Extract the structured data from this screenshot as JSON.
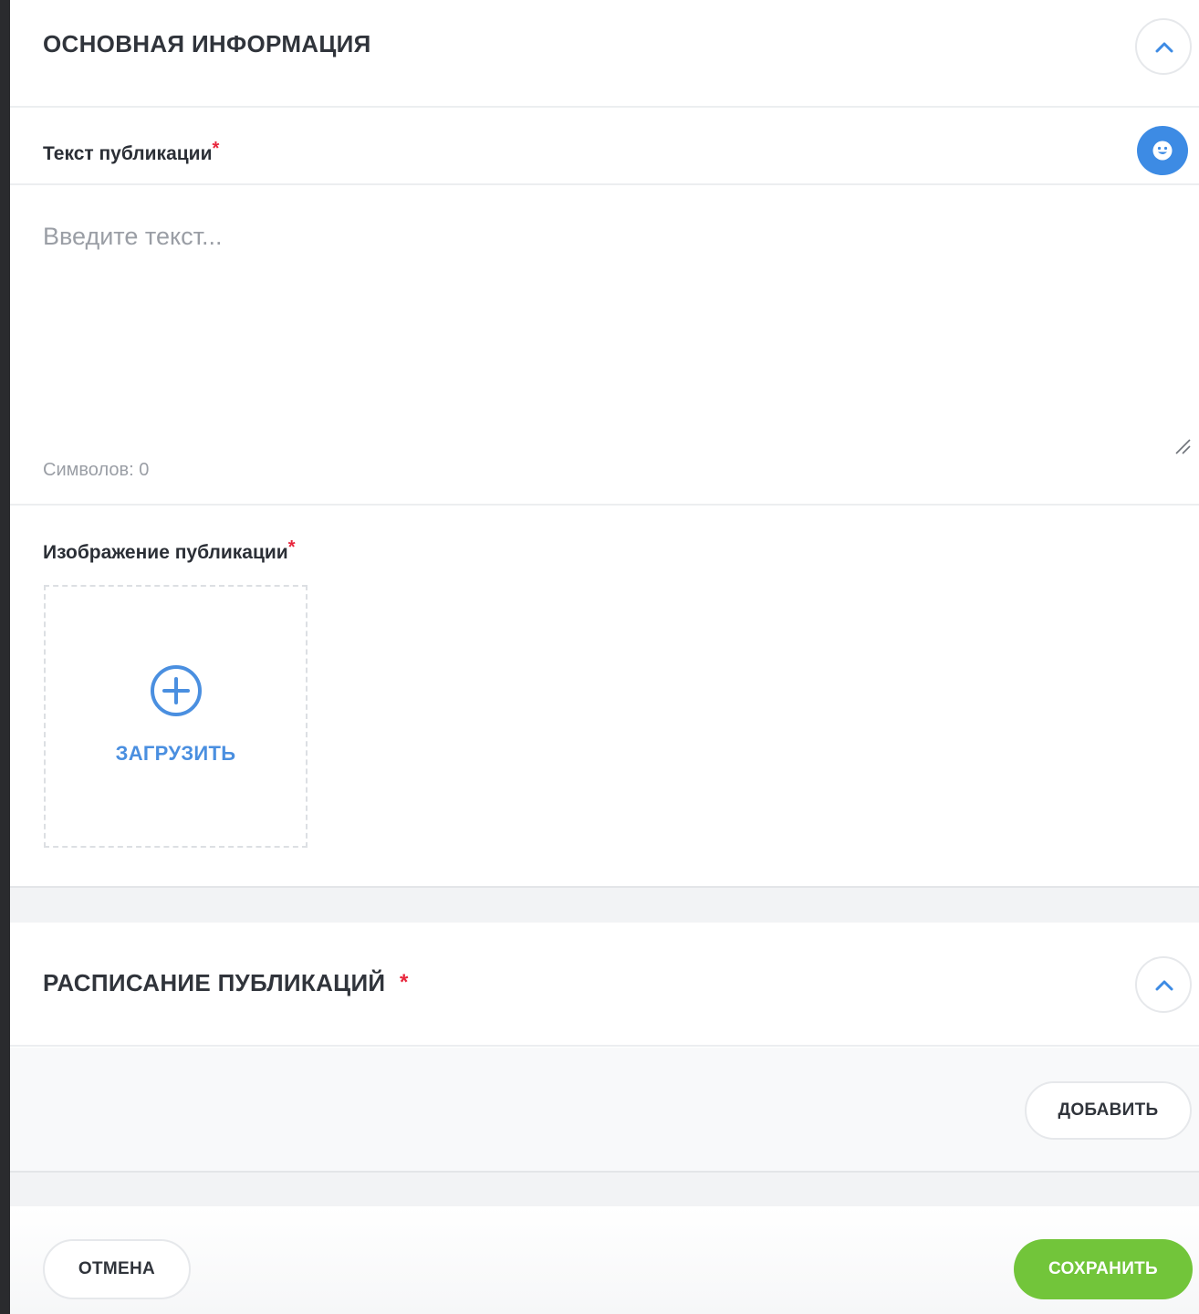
{
  "main_info": {
    "title": "ОСНОВНАЯ ИНФОРМАЦИЯ",
    "text_field": {
      "label": "Текст публикации",
      "required_mark": "*",
      "placeholder": "Введите текст...",
      "value": "",
      "char_count_text": "Символов: 0"
    },
    "image_field": {
      "label": "Изображение публикации",
      "required_mark": "*",
      "upload_label": "ЗАГРУЗИТЬ"
    }
  },
  "schedule": {
    "title": "РАСПИСАНИЕ ПУБЛИКАЦИЙ",
    "required_mark": "*",
    "add_label": "ДОБАВИТЬ"
  },
  "footer": {
    "cancel_label": "ОТМЕНА",
    "save_label": "СОХРАНИТЬ"
  },
  "icons": {
    "collapse": "chevron-up-icon",
    "emoji": "smiley-icon",
    "upload": "plus-circle-icon"
  },
  "colors": {
    "accent_blue": "#3d8be4",
    "upload_blue": "#4a8fe0",
    "save_green": "#72c53a",
    "required_red": "#e8263c"
  }
}
